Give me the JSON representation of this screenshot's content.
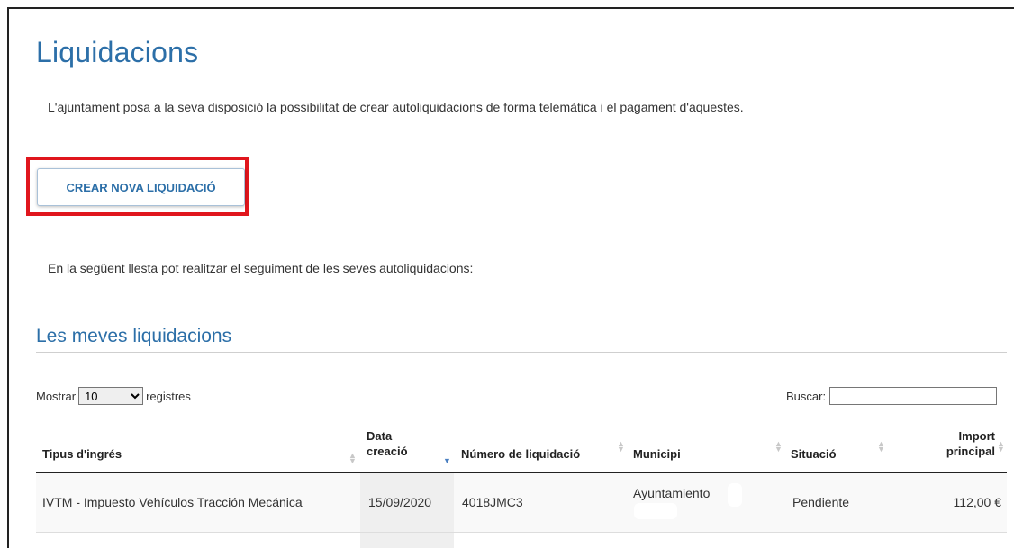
{
  "page": {
    "title": "Liquidacions",
    "intro": "L'ajuntament posa a la seva disposició la possibilitat de crear autoliquidacions de forma telemàtica i el pagament d'aquestes.",
    "create_button": "CREAR NOVA LIQUIDACIÓ",
    "follow_text": "En la següent llesta pot realitzar el seguiment de les seves autoliquidacions:",
    "section_title": "Les meves liquidacions"
  },
  "table_controls": {
    "show_label": "Mostrar",
    "page_length": "10",
    "page_length_options": [
      "10"
    ],
    "records_label": "registres",
    "search_label": "Buscar:",
    "search_value": ""
  },
  "table": {
    "columns": [
      {
        "label": "Tipus d'ingrés",
        "sort": "none"
      },
      {
        "label": "Data creació",
        "line1": "Data",
        "line2": "creació",
        "sort": "desc"
      },
      {
        "label": "Número de liquidació",
        "sort": "none"
      },
      {
        "label": "Municipi",
        "sort": "none"
      },
      {
        "label": "Situació",
        "sort": "none"
      },
      {
        "label": "Import principal",
        "line1": "Import",
        "line2": "principal",
        "sort": "none"
      }
    ],
    "rows": [
      {
        "tipus": "IVTM - Impuesto Vehículos Tracción Mecánica",
        "data": "15/09/2020",
        "numero": "4018JMC3",
        "municipi": "Ayuntamiento",
        "situacio": "Pendiente",
        "import": "112,00 €"
      }
    ]
  },
  "colors": {
    "accent": "#2c6fa8",
    "highlight_border": "#e0161d"
  }
}
